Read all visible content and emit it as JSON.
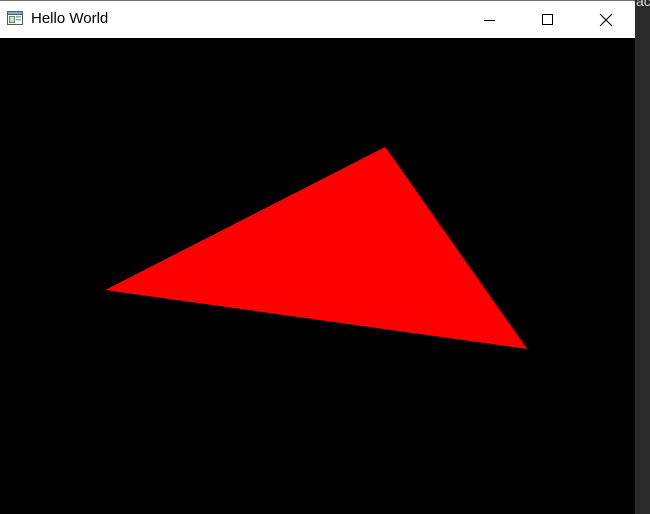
{
  "window": {
    "title": "Hello World",
    "app_icon": "window-app-icon",
    "controls": {
      "minimize_icon": "minimize-icon",
      "maximize_icon": "maximize-icon",
      "close_icon": "close-icon"
    }
  },
  "canvas": {
    "background_color": "#000000",
    "shape": "triangle",
    "fill_color": "#ff0000"
  },
  "desktop": {
    "background_color": "#2b2b2b",
    "edge_text": "ac"
  }
}
